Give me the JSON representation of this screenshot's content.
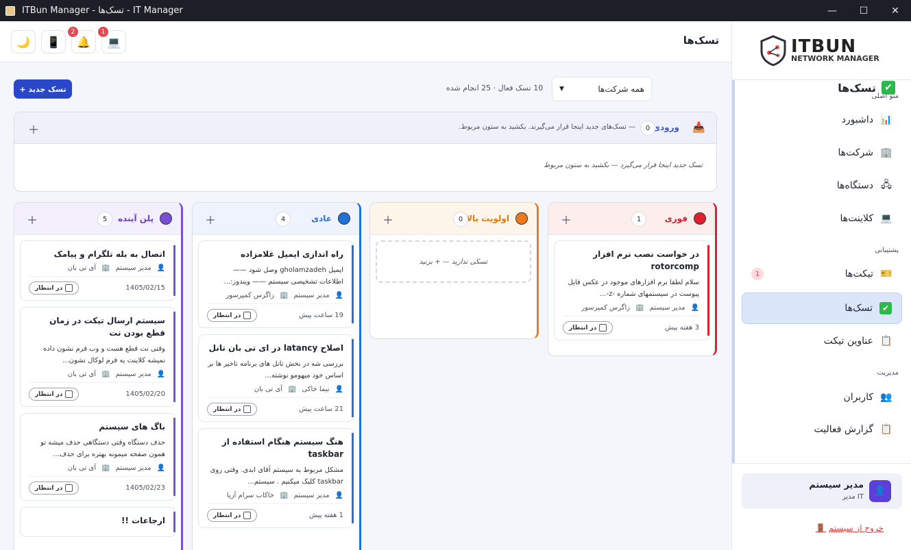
{
  "window": {
    "title": "ITBun Manager - تسک‌ها - IT Manager",
    "controls": [
      "—",
      "☐",
      "✕"
    ]
  },
  "colors": {
    "primary": "#2947c7",
    "accent": "#3d58c7",
    "danger": "#e5484d",
    "success": "#2db84c"
  },
  "sidebar": {
    "logo_main": "ITBUN",
    "logo_sub": "NETWORK MANAGER",
    "sections": {
      "main": "منو اصلی",
      "support": "پشتیبانی",
      "management": "مدیریت"
    },
    "items": [
      {
        "label": "داشبورد",
        "icon": "📊"
      },
      {
        "label": "شرکت‌ها",
        "icon": "🏢"
      },
      {
        "label": "دستگاه‌ها",
        "icon": "🖧"
      },
      {
        "label": "کلاینت‌ها",
        "icon": "💻"
      },
      {
        "label": "تیکت‌ها",
        "icon": "🎫",
        "badge": "1"
      },
      {
        "label": "تسک‌ها",
        "icon": "✔"
      },
      {
        "label": "عناوین تیکت",
        "icon": "📋"
      },
      {
        "label": "کاربران",
        "icon": "👥"
      },
      {
        "label": "گزارش فعالیت",
        "icon": "📋"
      }
    ],
    "user": {
      "name": "مدیر سیستم",
      "role": "مدیر IT",
      "avatar": "👤"
    },
    "logout": "خروج از سیستم"
  },
  "header": {
    "page_title": "تسک‌ها",
    "icons": [
      "🌙",
      "📱",
      "🔔",
      "💻"
    ],
    "notif_badge": "2",
    "device_badge": "1"
  },
  "toolbar": {
    "new_task": "+ تسک جدید",
    "heading": "تسک‌ها",
    "company_select": "همه شرکت‌ها",
    "summary": "10 تسک فعال · 25 انجام شده"
  },
  "inbox": {
    "title": "ورودی",
    "count": "0",
    "hint": "— تسک‌های جدید اینجا قرار می‌گیرند. بکشید به ستون مربوط.",
    "empty": "تسک جدید اینجا قرار می‌گیرد — بکشید به ستون مربوط"
  },
  "columns": [
    {
      "name": "فوری",
      "count": "1",
      "color": "#e0202f",
      "text": "#d0202c",
      "bg": "#fdeeee",
      "cards": [
        {
          "title": "در خواست نصب نرم افزار rotorcomp",
          "desc": "سلام لطفا نرم افزارهای موجود در عکس فایل پیوست در سیستمهای شماره -z-...",
          "user": "مدیر سیستم",
          "company": "زاگرس کمپرسور",
          "time": "3 هفته پیش",
          "status": "در انتظار"
        }
      ]
    },
    {
      "name": "اولویت بالا",
      "count": "0",
      "color": "#f07a1a",
      "text": "#e07a10",
      "bg": "#fdf5ea",
      "empty": "تسکی ندارید — + بزنید",
      "cards": []
    },
    {
      "name": "عادی",
      "count": "4",
      "color": "#1f72d8",
      "text": "#2a6fd0",
      "bg": "#eef3fd",
      "cards": [
        {
          "title": "راه اندازی ایمیل غلامزاده",
          "desc": "ایمیل gholamzadeh وصل شود —— اطلاعات تشخیصی سیستم —— ویندوز:...",
          "user": "مدیر سیستم",
          "company": "زاگرس کمپرسور",
          "time": "19 ساعت پیش",
          "status": "در انتظار"
        },
        {
          "title": "اصلاح latancy در ای تی بان تانل",
          "desc": "بررسی شه در بخش تانل های برنامه تاخیر ها بر اساس خود میهومو نوشته...",
          "user": "نیما خاکی",
          "company": "آی تی بان",
          "time": "21 ساعت پیش",
          "status": "در انتظار"
        },
        {
          "title": "هنگ سیستم هنگام استفاده از taskbar",
          "desc": "مشکل مربوط به سیستم آقای ابدی. وقتی روی taskbar کلیک میکنیم . سیستم...",
          "user": "مدیر سیستم",
          "company": "خاکاب سرام آریا",
          "time": "1 هفته پیش",
          "status": "در انتظار"
        }
      ]
    },
    {
      "name": "پلن آینده",
      "count": "5",
      "color": "#7a4fd8",
      "text": "#6a3fc8",
      "bg": "#f3effc",
      "cards": [
        {
          "title": "اتصال به بله تلگرام و پیامک",
          "desc": "",
          "user": "مدیر سیستم",
          "company": "آی تی بان",
          "time": "1405/02/15",
          "status": "در انتظار"
        },
        {
          "title": "سیستم ارسال تیکت در زمان قطع بودن نت",
          "desc": "وقتی نت قطع هست و وب فرم نشون داده نمیشه کلاینت یه فرم لوکال نشون...",
          "user": "مدیر سیستم",
          "company": "آی تی بان",
          "time": "1405/02/20",
          "status": "در انتظار"
        },
        {
          "title": "باگ های سیستم",
          "desc": "حذف دستگاه وقتی دستگاهی حذف میشه تو همون صفحه میمونه بهتره برای حذف...",
          "user": "مدیر سیستم",
          "company": "آی تی بان",
          "time": "1405/02/23",
          "status": "در انتظار"
        },
        {
          "title": "ارجاعات !!",
          "desc": "",
          "user": "",
          "company": "",
          "time": "",
          "status": ""
        }
      ]
    }
  ]
}
